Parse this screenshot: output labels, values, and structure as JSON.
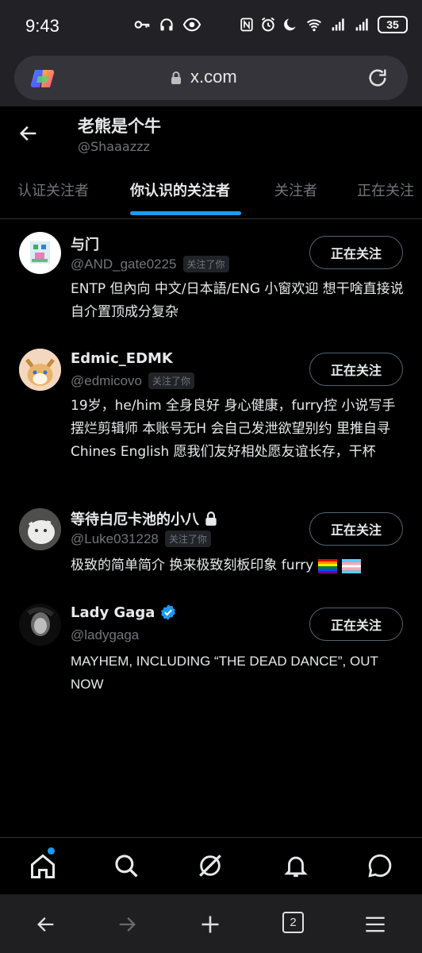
{
  "status_bar": {
    "time": "9:43",
    "battery": "35"
  },
  "browser": {
    "url": "x.com",
    "tab_count": "2"
  },
  "header": {
    "name": "老熊是个牛",
    "handle": "@Shaaazzz"
  },
  "tabs": [
    {
      "label": "认证关注者"
    },
    {
      "label": "你认识的关注者"
    },
    {
      "label": "关注者"
    },
    {
      "label": "正在关注"
    }
  ],
  "users": [
    {
      "name": "与门",
      "handle": "@AND_gate0225",
      "badge": "关注了你",
      "button": "正在关注",
      "bio": "ENTP 但內向 中文/日本語/ENG 小窗欢迎 想干啥直接说 自介置顶成分复杂"
    },
    {
      "name": "Edmic_EDMK",
      "handle": "@edmicovo",
      "badge": "关注了你",
      "button": "正在关注",
      "bio": "19岁，he/him 全身良好 身心健康，furry控 小说写手 摆烂剪辑师 本账号无H 会自己发泄欲望别约 里推自寻 Chines English 愿我们友好相处愿友谊长存，干杯"
    },
    {
      "name": "等待白厄卡池的小八",
      "handle": "@Luke031228",
      "badge": "关注了你",
      "button": "正在关注",
      "bio": "极致的简单简介 换来极致刻板印象 furry"
    },
    {
      "name": "Lady Gaga",
      "handle": "@ladygaga",
      "badge": "",
      "button": "正在关注",
      "bio": "MAYHEM, INCLUDING “THE DEAD DANCE”, OUT NOW"
    }
  ],
  "colors": {
    "accent": "#1d9bf0",
    "muted": "#71767b",
    "text": "#e7e9ea",
    "background": "#000000"
  }
}
